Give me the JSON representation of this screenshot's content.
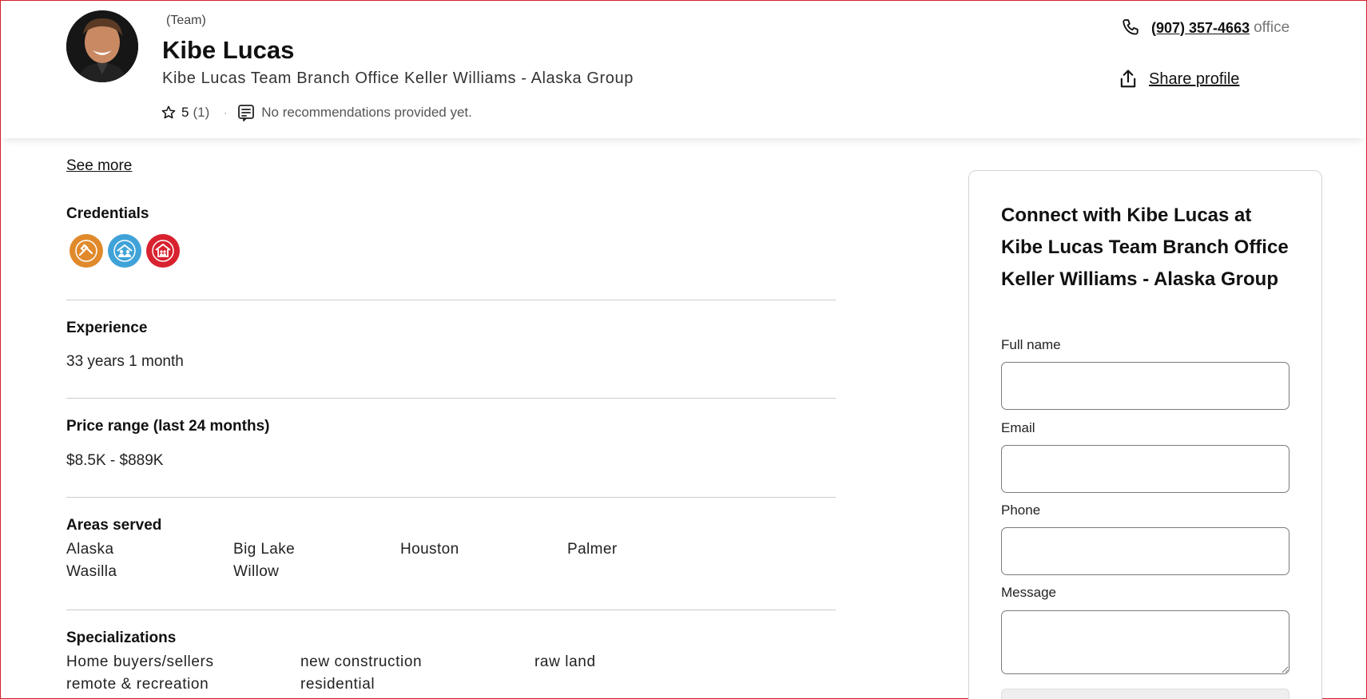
{
  "header": {
    "team_tag": "(Team)",
    "name": "Kibe Lucas",
    "office": "Kibe Lucas Team Branch Office Keller Williams - Alaska Group",
    "rating": "5",
    "rating_count": "(1)",
    "separator": "·",
    "recommendations": "No recommendations provided yet.",
    "phone": "(907) 357-4663",
    "phone_type": "office",
    "share_label": "Share profile",
    "icons": [
      "star-icon",
      "recommendation-icon",
      "phone-icon",
      "share-icon"
    ]
  },
  "main": {
    "see_more": "See more",
    "credentials": {
      "title": "Credentials",
      "badges": [
        {
          "name": "credential-badge-1",
          "color": "#e08a2c"
        },
        {
          "name": "credential-badge-2",
          "color": "#3fa3d8"
        },
        {
          "name": "credential-badge-3",
          "color": "#d8222f"
        }
      ]
    },
    "experience": {
      "title": "Experience",
      "value": "33 years 1 month"
    },
    "price_range": {
      "title": "Price range (last 24 months)",
      "value": "$8.5K - $889K"
    },
    "areas_served": {
      "title": "Areas served",
      "items": [
        "Alaska",
        "Big Lake",
        "Houston",
        "Palmer",
        "Wasilla",
        "Willow"
      ]
    },
    "specializations": {
      "title": "Specializations",
      "items": [
        "Home buyers/sellers",
        "new construction",
        "raw land",
        "remote & recreation",
        "residential"
      ]
    }
  },
  "contact": {
    "title": "Connect with Kibe Lucas at Kibe Lucas Team Branch Office Keller Williams - Alaska Group",
    "full_name_label": "Full name",
    "full_name_value": "",
    "email_label": "Email",
    "email_value": "",
    "phone_label": "Phone",
    "phone_value": "",
    "message_label": "Message",
    "message_value": ""
  },
  "colors": {
    "accent_red": "#d6202b",
    "divider": "#cccccc",
    "border": "#7a7a7a"
  }
}
